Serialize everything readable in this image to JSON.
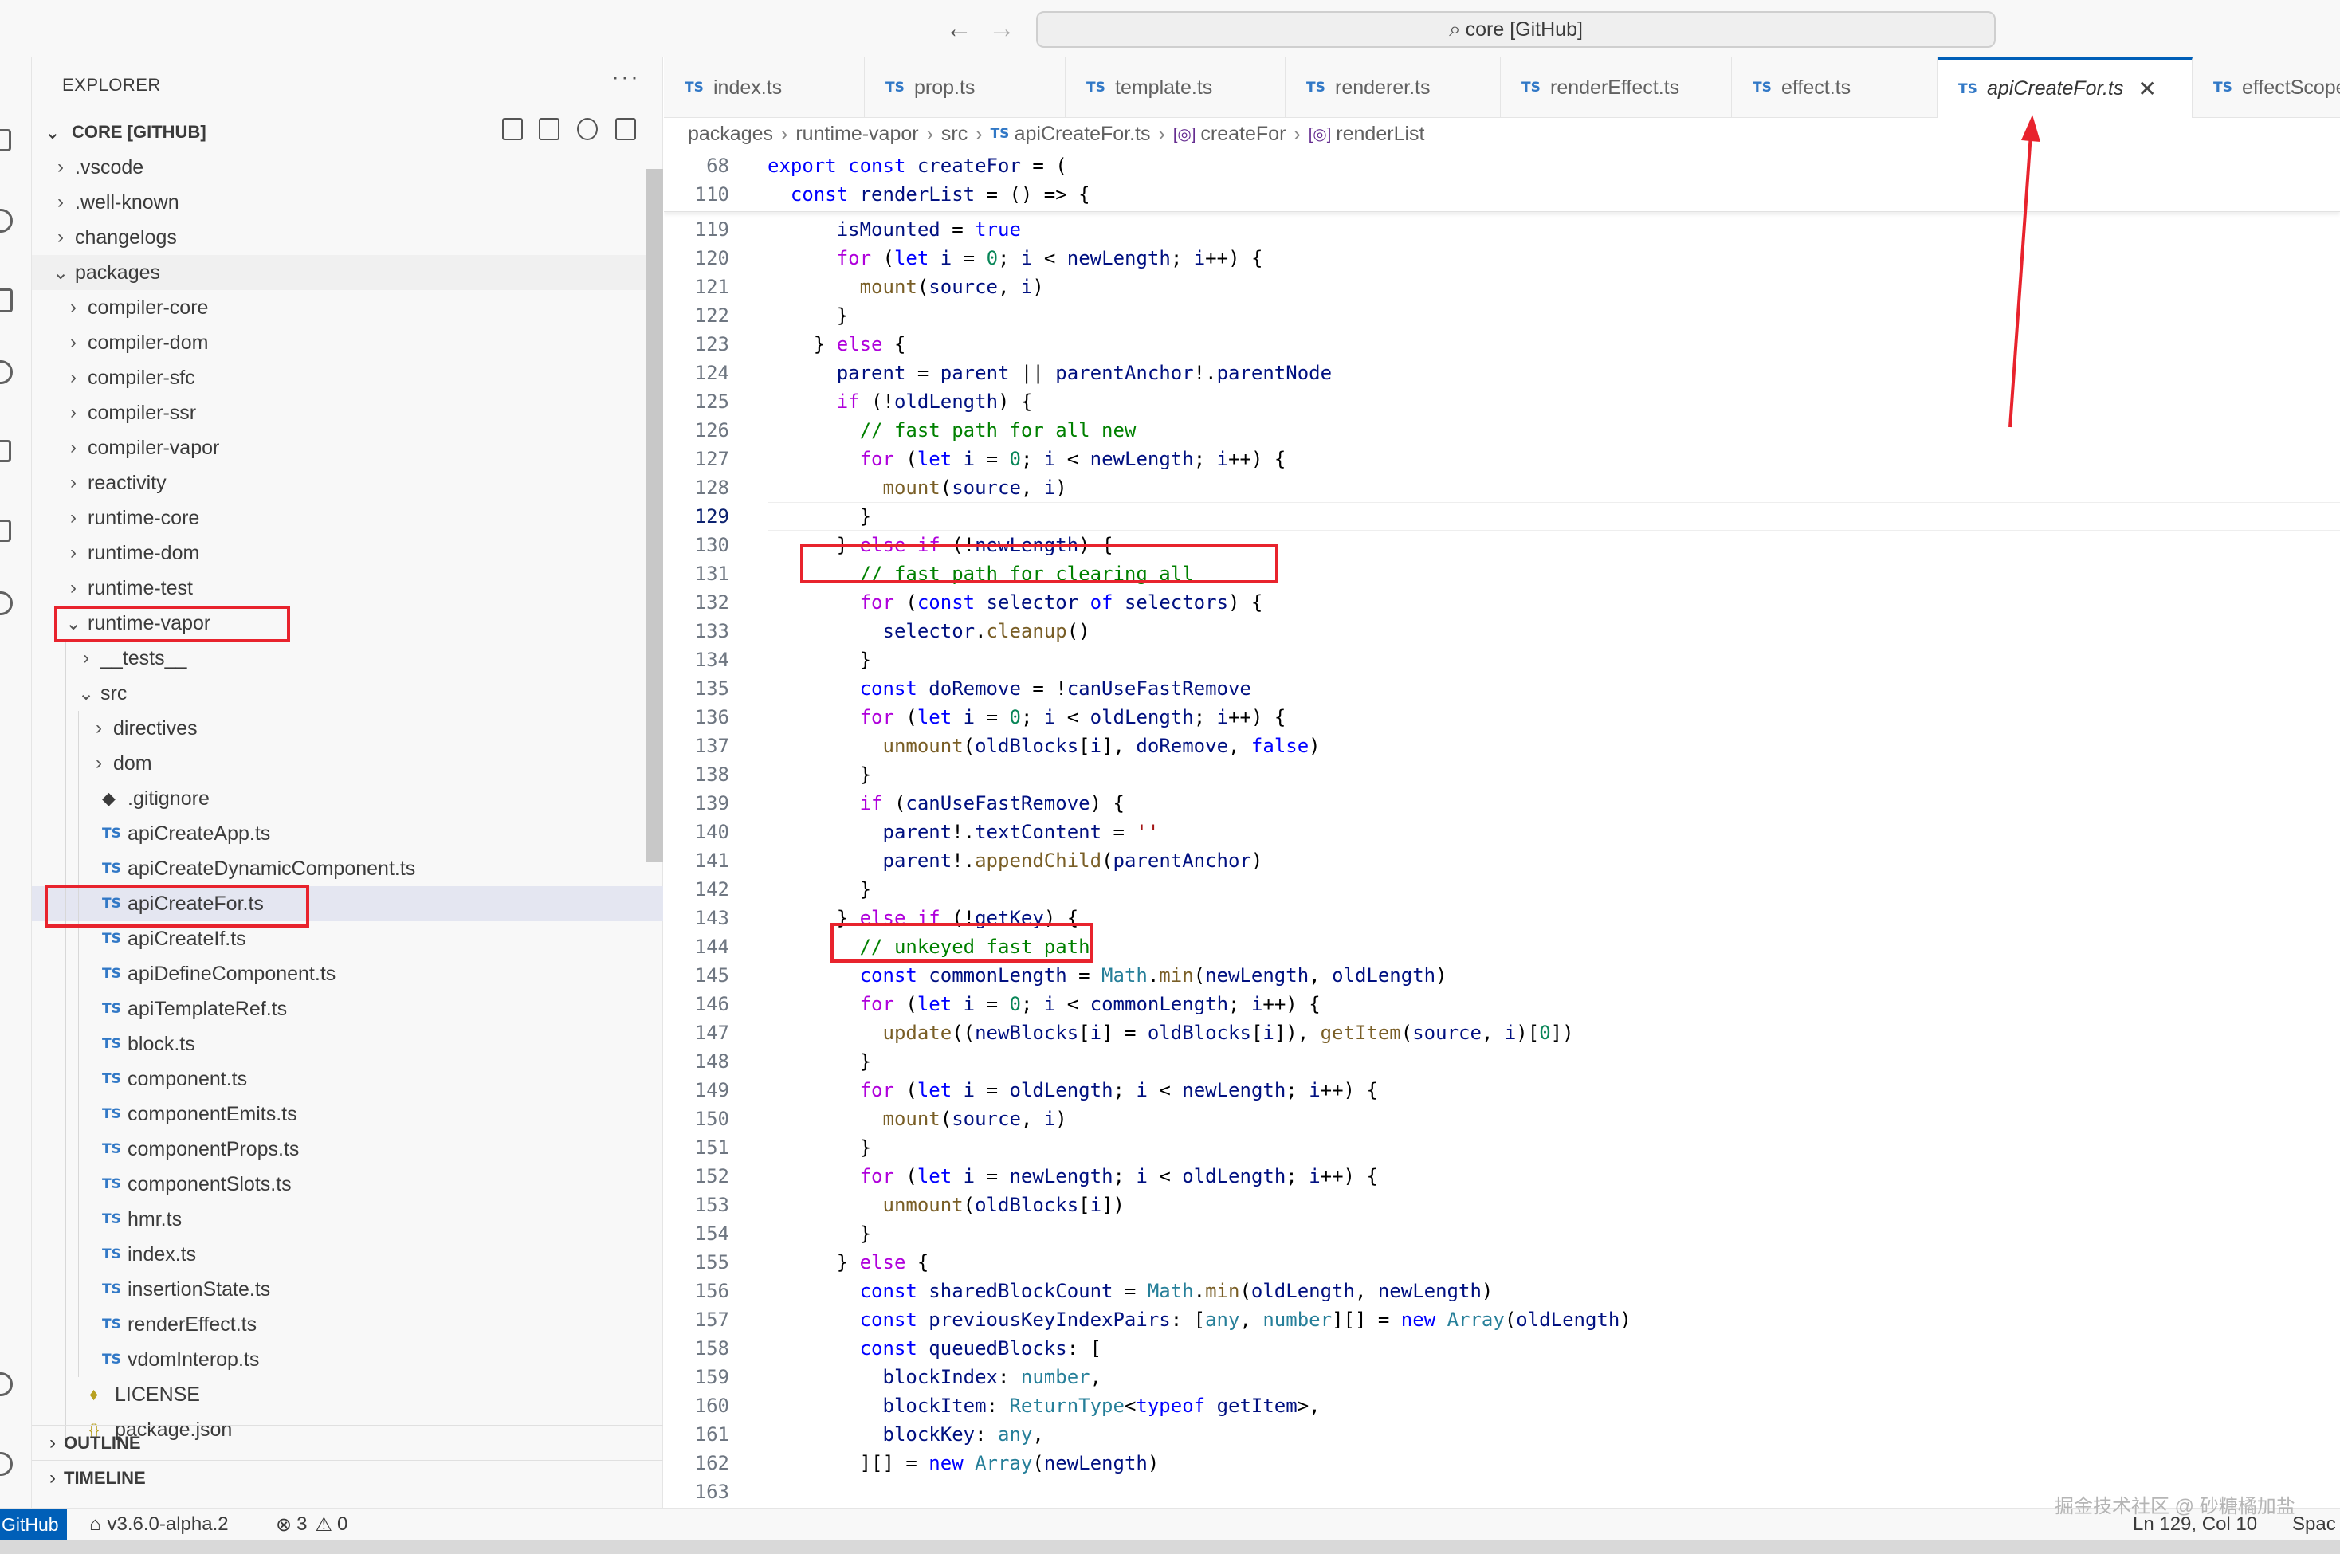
{
  "titlebar": {
    "back": "←",
    "forward": "→",
    "command_center": "core [GitHub]"
  },
  "sidebar": {
    "title": "EXPLORER",
    "more": "···",
    "root": "CORE [GITHUB]",
    "tree": [
      {
        "label": ".vscode",
        "kind": "folder",
        "depth": 1,
        "open": false
      },
      {
        "label": ".well-known",
        "kind": "folder",
        "depth": 1,
        "open": false
      },
      {
        "label": "changelogs",
        "kind": "folder",
        "depth": 1,
        "open": false
      },
      {
        "label": "packages",
        "kind": "folder",
        "depth": 1,
        "open": true
      },
      {
        "label": "compiler-core",
        "kind": "folder",
        "depth": 2,
        "open": false
      },
      {
        "label": "compiler-dom",
        "kind": "folder",
        "depth": 2,
        "open": false
      },
      {
        "label": "compiler-sfc",
        "kind": "folder",
        "depth": 2,
        "open": false
      },
      {
        "label": "compiler-ssr",
        "kind": "folder",
        "depth": 2,
        "open": false
      },
      {
        "label": "compiler-vapor",
        "kind": "folder",
        "depth": 2,
        "open": false
      },
      {
        "label": "reactivity",
        "kind": "folder",
        "depth": 2,
        "open": false
      },
      {
        "label": "runtime-core",
        "kind": "folder",
        "depth": 2,
        "open": false
      },
      {
        "label": "runtime-dom",
        "kind": "folder",
        "depth": 2,
        "open": false
      },
      {
        "label": "runtime-test",
        "kind": "folder",
        "depth": 2,
        "open": false
      },
      {
        "label": "runtime-vapor",
        "kind": "folder",
        "depth": 2,
        "open": true
      },
      {
        "label": "__tests__",
        "kind": "folder",
        "depth": 3,
        "open": false
      },
      {
        "label": "src",
        "kind": "folder",
        "depth": 3,
        "open": true
      },
      {
        "label": "directives",
        "kind": "folder",
        "depth": 4,
        "open": false
      },
      {
        "label": "dom",
        "kind": "folder",
        "depth": 4,
        "open": false
      },
      {
        "label": ".gitignore",
        "kind": "git",
        "depth": 4
      },
      {
        "label": "apiCreateApp.ts",
        "kind": "ts",
        "depth": 4
      },
      {
        "label": "apiCreateDynamicComponent.ts",
        "kind": "ts",
        "depth": 4
      },
      {
        "label": "apiCreateFor.ts",
        "kind": "ts",
        "depth": 4,
        "selected": true
      },
      {
        "label": "apiCreateIf.ts",
        "kind": "ts",
        "depth": 4
      },
      {
        "label": "apiDefineComponent.ts",
        "kind": "ts",
        "depth": 4
      },
      {
        "label": "apiTemplateRef.ts",
        "kind": "ts",
        "depth": 4
      },
      {
        "label": "block.ts",
        "kind": "ts",
        "depth": 4
      },
      {
        "label": "component.ts",
        "kind": "ts",
        "depth": 4
      },
      {
        "label": "componentEmits.ts",
        "kind": "ts",
        "depth": 4
      },
      {
        "label": "componentProps.ts",
        "kind": "ts",
        "depth": 4
      },
      {
        "label": "componentSlots.ts",
        "kind": "ts",
        "depth": 4
      },
      {
        "label": "hmr.ts",
        "kind": "ts",
        "depth": 4
      },
      {
        "label": "index.ts",
        "kind": "ts",
        "depth": 4
      },
      {
        "label": "insertionState.ts",
        "kind": "ts",
        "depth": 4
      },
      {
        "label": "renderEffect.ts",
        "kind": "ts",
        "depth": 4
      },
      {
        "label": "vdomInterop.ts",
        "kind": "ts",
        "depth": 4
      },
      {
        "label": "LICENSE",
        "kind": "license",
        "depth": 3
      },
      {
        "label": "package.json",
        "kind": "json",
        "depth": 3
      }
    ],
    "outline": "OUTLINE",
    "timeline": "TIMELINE"
  },
  "tabs": [
    {
      "label": "index.ts"
    },
    {
      "label": "prop.ts"
    },
    {
      "label": "template.ts"
    },
    {
      "label": "renderer.ts"
    },
    {
      "label": "renderEffect.ts"
    },
    {
      "label": "effect.ts"
    },
    {
      "label": "apiCreateFor.ts",
      "active": true
    },
    {
      "label": "effectScope.ts"
    }
  ],
  "ts_badge": "TS",
  "close_glyph": "✕",
  "breadcrumb": [
    "packages",
    "runtime-vapor",
    "src",
    "apiCreateFor.ts",
    "createFor",
    "renderList"
  ],
  "editor": {
    "current_line": "129",
    "sticky": [
      {
        "n": "68",
        "code": "export const createFor = ("
      },
      {
        "n": "110",
        "code": "  const renderList = () => {"
      }
    ],
    "lines": [
      {
        "n": "119",
        "code": "      isMounted = true"
      },
      {
        "n": "120",
        "code": "      for (let i = 0; i < newLength; i++) {"
      },
      {
        "n": "121",
        "code": "        mount(source, i)"
      },
      {
        "n": "122",
        "code": "      }"
      },
      {
        "n": "123",
        "code": "    } else {"
      },
      {
        "n": "124",
        "code": "      parent = parent || parentAnchor!.parentNode"
      },
      {
        "n": "125",
        "code": "      if (!oldLength) {"
      },
      {
        "n": "126",
        "code": "        // fast path for all new"
      },
      {
        "n": "127",
        "code": "        for (let i = 0; i < newLength; i++) {"
      },
      {
        "n": "128",
        "code": "          mount(source, i)"
      },
      {
        "n": "129",
        "code": "        }"
      },
      {
        "n": "130",
        "code": "      } else if (!newLength) {"
      },
      {
        "n": "131",
        "code": "        // fast path for clearing all"
      },
      {
        "n": "132",
        "code": "        for (const selector of selectors) {"
      },
      {
        "n": "133",
        "code": "          selector.cleanup()"
      },
      {
        "n": "134",
        "code": "        }"
      },
      {
        "n": "135",
        "code": "        const doRemove = !canUseFastRemove"
      },
      {
        "n": "136",
        "code": "        for (let i = 0; i < oldLength; i++) {"
      },
      {
        "n": "137",
        "code": "          unmount(oldBlocks[i], doRemove, false)"
      },
      {
        "n": "138",
        "code": "        }"
      },
      {
        "n": "139",
        "code": "        if (canUseFastRemove) {"
      },
      {
        "n": "140",
        "code": "          parent!.textContent = ''"
      },
      {
        "n": "141",
        "code": "          parent!.appendChild(parentAnchor)"
      },
      {
        "n": "142",
        "code": "        }"
      },
      {
        "n": "143",
        "code": "      } else if (!getKey) {"
      },
      {
        "n": "144",
        "code": "        // unkeyed fast path"
      },
      {
        "n": "145",
        "code": "        const commonLength = Math.min(newLength, oldLength)"
      },
      {
        "n": "146",
        "code": "        for (let i = 0; i < commonLength; i++) {"
      },
      {
        "n": "147",
        "code": "          update((newBlocks[i] = oldBlocks[i]), getItem(source, i)[0])"
      },
      {
        "n": "148",
        "code": "        }"
      },
      {
        "n": "149",
        "code": "        for (let i = oldLength; i < newLength; i++) {"
      },
      {
        "n": "150",
        "code": "          mount(source, i)"
      },
      {
        "n": "151",
        "code": "        }"
      },
      {
        "n": "152",
        "code": "        for (let i = newLength; i < oldLength; i++) {"
      },
      {
        "n": "153",
        "code": "          unmount(oldBlocks[i])"
      },
      {
        "n": "154",
        "code": "        }"
      },
      {
        "n": "155",
        "code": "      } else {"
      },
      {
        "n": "156",
        "code": "        const sharedBlockCount = Math.min(oldLength, newLength)"
      },
      {
        "n": "157",
        "code": "        const previousKeyIndexPairs: [any, number][] = new Array(oldLength)"
      },
      {
        "n": "158",
        "code": "        const queuedBlocks: ["
      },
      {
        "n": "159",
        "code": "          blockIndex: number,"
      },
      {
        "n": "160",
        "code": "          blockItem: ReturnType<typeof getItem>,"
      },
      {
        "n": "161",
        "code": "          blockKey: any,"
      },
      {
        "n": "162",
        "code": "        ][] = new Array(newLength)"
      },
      {
        "n": "163",
        "code": ""
      }
    ]
  },
  "statusbar": {
    "remote": "GitHub",
    "branch": "v3.6.0-alpha.2",
    "errors": "3",
    "warnings": "0",
    "cursor": "Ln 129, Col 10",
    "spaces": "Spac"
  },
  "watermark": "掘金技术社区 @ 砂糖橘加盐",
  "colors": {
    "accent": "#005fb8",
    "annotation": "#e8232d",
    "ts": "#3178c6"
  }
}
